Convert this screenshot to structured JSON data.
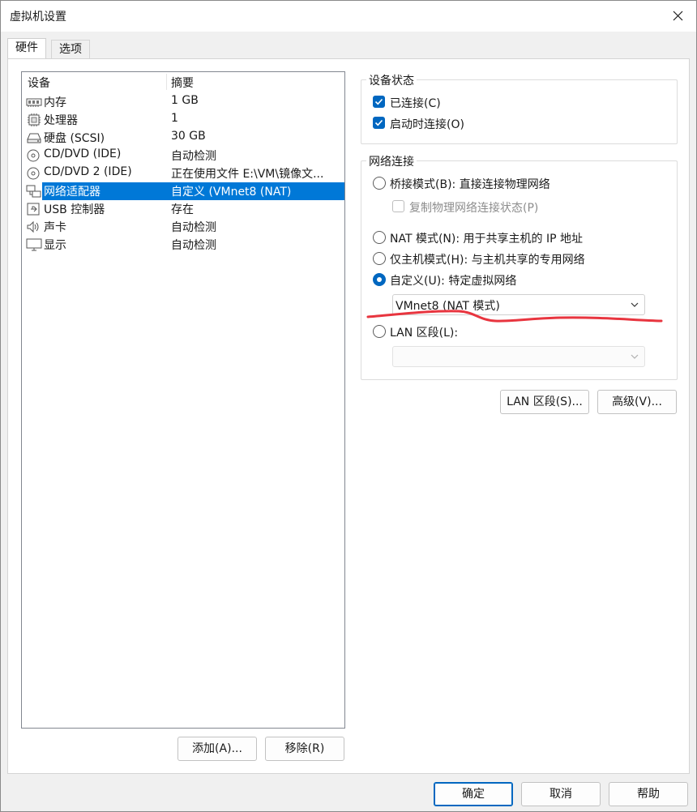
{
  "window": {
    "title": "虚拟机设置"
  },
  "tabs": [
    {
      "label": "硬件"
    },
    {
      "label": "选项"
    }
  ],
  "device_list": {
    "columns": {
      "device": "设备",
      "summary": "摘要"
    },
    "rows": [
      {
        "icon": "memory-icon",
        "name": "内存",
        "summary": "1 GB"
      },
      {
        "icon": "processor-icon",
        "name": "处理器",
        "summary": "1"
      },
      {
        "icon": "hard-disk-icon",
        "name": "硬盘 (SCSI)",
        "summary": "30 GB"
      },
      {
        "icon": "cd-dvd-icon",
        "name": "CD/DVD (IDE)",
        "summary": "自动检测"
      },
      {
        "icon": "cd-dvd-icon",
        "name": "CD/DVD 2 (IDE)",
        "summary": "正在使用文件 E:\\VM\\镜像文..."
      },
      {
        "icon": "network-adapter-icon",
        "name": "网络适配器",
        "summary": "自定义 (VMnet8 (NAT)",
        "selected": true
      },
      {
        "icon": "usb-icon",
        "name": "USB 控制器",
        "summary": "存在"
      },
      {
        "icon": "speaker-icon",
        "name": "声卡",
        "summary": "自动检测"
      },
      {
        "icon": "monitor-icon",
        "name": "显示",
        "summary": "自动检测"
      }
    ]
  },
  "device_buttons": {
    "add": "添加(A)...",
    "remove": "移除(R)"
  },
  "device_status": {
    "title": "设备状态",
    "connected": {
      "label": "已连接(C)",
      "checked": true
    },
    "connect_at_power_on": {
      "label": "启动时连接(O)",
      "checked": true
    }
  },
  "network_connection": {
    "title": "网络连接",
    "bridged": {
      "label": "桥接模式(B): 直接连接物理网络",
      "checked": false
    },
    "replicate": {
      "label": "复制物理网络连接状态(P)",
      "checked": false
    },
    "nat": {
      "label": "NAT 模式(N): 用于共享主机的 IP 地址",
      "checked": false
    },
    "host_only": {
      "label": "仅主机模式(H): 与主机共享的专用网络",
      "checked": false
    },
    "custom": {
      "label": "自定义(U): 特定虚拟网络",
      "checked": true
    },
    "custom_select": {
      "value": "VMnet8 (NAT 模式)"
    },
    "lan_segment": {
      "label": "LAN 区段(L):",
      "checked": false
    },
    "lan_select": {
      "value": ""
    }
  },
  "network_buttons": {
    "lan_segments": "LAN 区段(S)...",
    "advanced": "高级(V)..."
  },
  "footer_buttons": {
    "ok": "确定",
    "cancel": "取消",
    "help": "帮助"
  },
  "colors": {
    "accent": "#0067c0",
    "selection": "#0078d7",
    "annotation": "#e8353f"
  }
}
